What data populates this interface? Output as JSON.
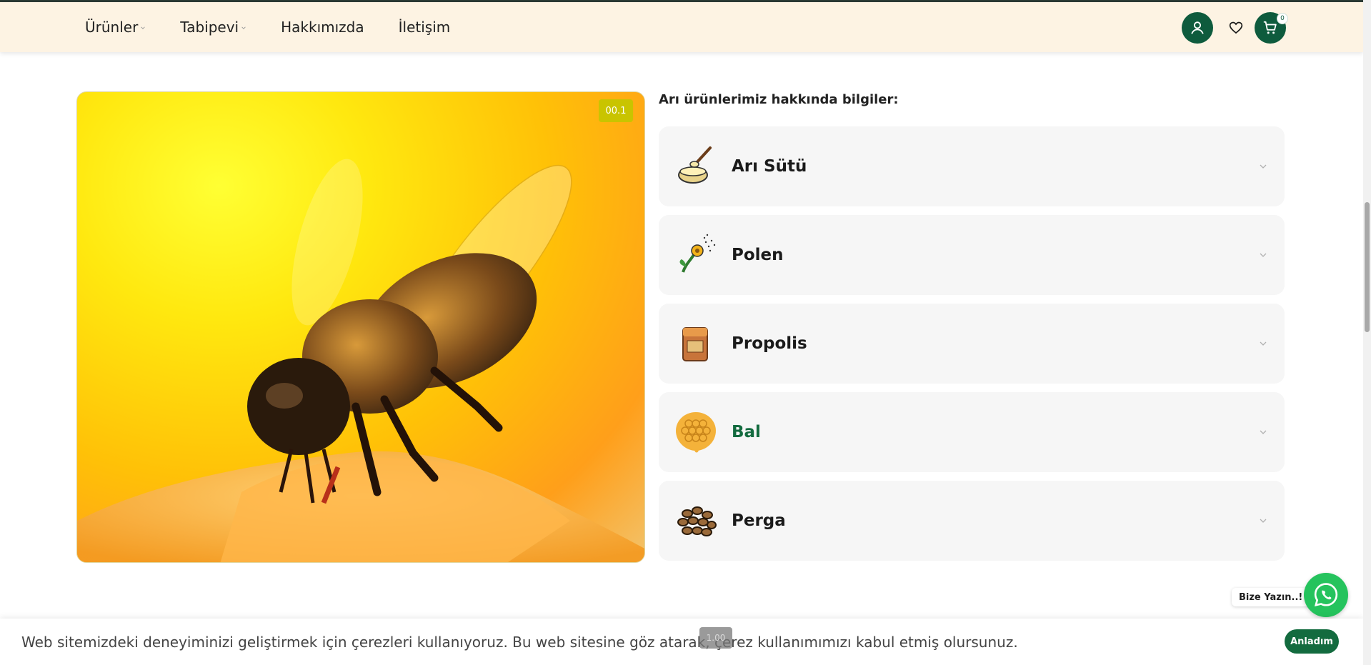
{
  "header": {
    "nav": [
      {
        "label": "Ürünler",
        "has_dropdown": true
      },
      {
        "label": "Tabipevi",
        "has_dropdown": true
      },
      {
        "label": "Hakkımızda",
        "has_dropdown": false
      },
      {
        "label": "İletişim",
        "has_dropdown": false
      }
    ],
    "icons": [
      "user-icon",
      "heart-icon",
      "cart-icon"
    ],
    "cart_count": "0"
  },
  "hero": {
    "time_label": "00.1",
    "image": "bee-on-honeycomb"
  },
  "info": {
    "title": "Arı ürünlerimiz hakkında bilgiler:",
    "items": [
      {
        "label": "Arı Sütü",
        "icon": "royal-jelly-icon",
        "active": false
      },
      {
        "label": "Polen",
        "icon": "pollen-icon",
        "active": false
      },
      {
        "label": "Propolis",
        "icon": "propolis-icon",
        "active": false
      },
      {
        "label": "Bal",
        "icon": "honeycomb-icon",
        "active": true
      },
      {
        "label": "Perga",
        "icon": "perga-icon",
        "active": false
      }
    ]
  },
  "whatsapp": {
    "label": "Bize Yazın..!"
  },
  "cookie": {
    "text": "Web sitemizdeki deneyiminizi geliştirmek için çerezleri kullanıyoruz. Bu web sitesine göz atarak, çerez kullanımımızı kabul etmiş olursunuz.",
    "button": "Anladım"
  },
  "overlay_tag": "1.00",
  "colors": {
    "header_bg": "#fdf3e3",
    "brand_green": "#0e5b3d",
    "active_green": "#136b3f",
    "whatsapp_green": "#25c35d",
    "card_bg": "#f6f6f6"
  }
}
